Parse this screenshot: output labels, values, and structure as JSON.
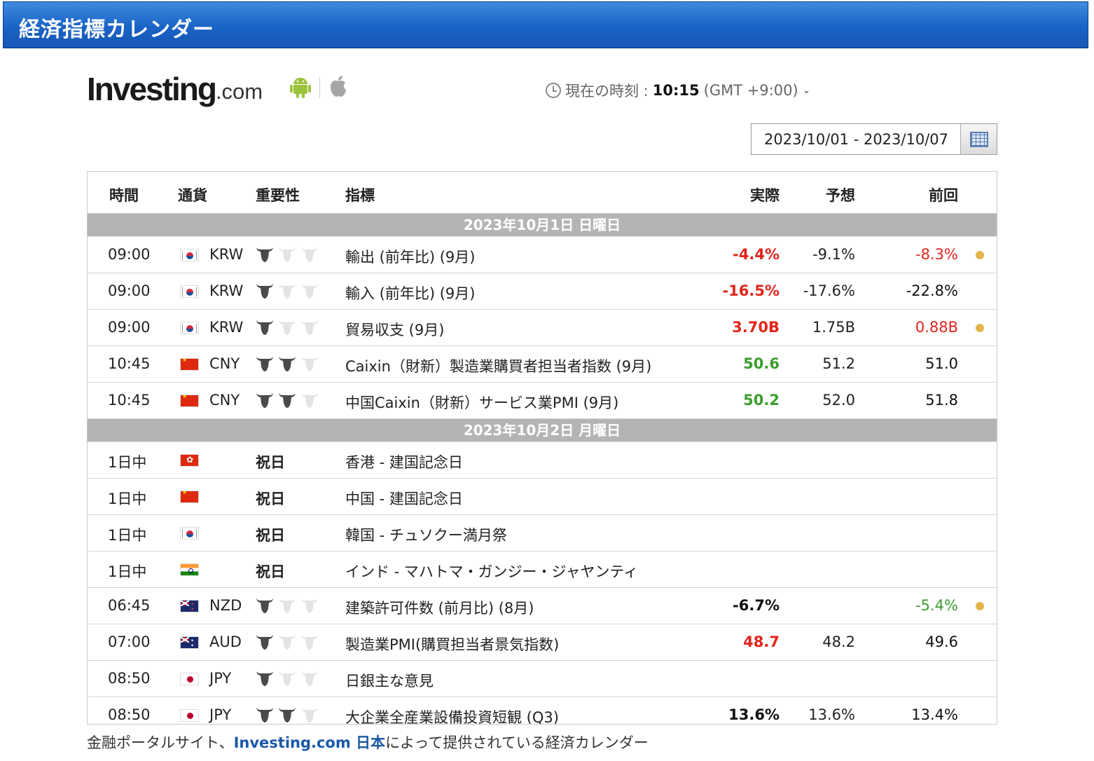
{
  "header": {
    "title": "経済指標カレンダー"
  },
  "logo": {
    "main": "Investing",
    "suffix": ".com"
  },
  "clock": {
    "label": "現在の時刻 : ",
    "time": "10:15",
    "tz": " (GMT +9:00)",
    "chevron": "⌄"
  },
  "date_range": {
    "value": "2023/10/01 - 2023/10/07"
  },
  "columns": {
    "time": "時間",
    "currency": "通貨",
    "importance": "重要性",
    "event": "指標",
    "actual": "実際",
    "forecast": "予想",
    "previous": "前回"
  },
  "groups": [
    {
      "date": "2023年10月1日 日曜日",
      "rows": [
        {
          "time": "09:00",
          "flag": "kr",
          "currency": "KRW",
          "importance": 1,
          "event": "輸出 (前年比) (9月)",
          "actual": "-4.4%",
          "actual_color": "red",
          "forecast": "-9.1%",
          "previous": "-8.3%",
          "previous_color": "red",
          "revised": true
        },
        {
          "time": "09:00",
          "flag": "kr",
          "currency": "KRW",
          "importance": 1,
          "event": "輸入 (前年比) (9月)",
          "actual": "-16.5%",
          "actual_color": "red",
          "forecast": "-17.6%",
          "previous": "-22.8%",
          "previous_color": "black",
          "revised": false
        },
        {
          "time": "09:00",
          "flag": "kr",
          "currency": "KRW",
          "importance": 1,
          "event": "貿易収支 (9月)",
          "actual": "3.70B",
          "actual_color": "red",
          "forecast": "1.75B",
          "previous": "0.88B",
          "previous_color": "red",
          "revised": true
        },
        {
          "time": "10:45",
          "flag": "cn",
          "currency": "CNY",
          "importance": 2,
          "event": "Caixin（財新）製造業購買者担当者指数 (9月)",
          "actual": "50.6",
          "actual_color": "green",
          "forecast": "51.2",
          "previous": "51.0",
          "previous_color": "black",
          "revised": false
        },
        {
          "time": "10:45",
          "flag": "cn",
          "currency": "CNY",
          "importance": 2,
          "event": "中国Caixin（財新）サービス業PMI (9月)",
          "actual": "50.2",
          "actual_color": "green",
          "forecast": "52.0",
          "previous": "51.8",
          "previous_color": "black",
          "revised": false
        }
      ]
    },
    {
      "date": "2023年10月2日 月曜日",
      "rows": [
        {
          "time": "1日中",
          "flag": "hk",
          "currency": "",
          "holiday": "祝日",
          "event": "香港 - 建国記念日"
        },
        {
          "time": "1日中",
          "flag": "cn",
          "currency": "",
          "holiday": "祝日",
          "event": "中国 - 建国記念日"
        },
        {
          "time": "1日中",
          "flag": "kr",
          "currency": "",
          "holiday": "祝日",
          "event": "韓国 - チュソクー満月祭"
        },
        {
          "time": "1日中",
          "flag": "in",
          "currency": "",
          "holiday": "祝日",
          "event": "インド - マハトマ・ガンジー・ジャヤンティ"
        },
        {
          "time": "06:45",
          "flag": "nz",
          "currency": "NZD",
          "importance": 1,
          "event": "建築許可件数 (前月比) (8月)",
          "actual": "-6.7%",
          "actual_color": "black",
          "forecast": "",
          "previous": "-5.4%",
          "previous_color": "green",
          "revised": true
        },
        {
          "time": "07:00",
          "flag": "au",
          "currency": "AUD",
          "importance": 1,
          "event": "製造業PMI(購買担当者景気指数)",
          "actual": "48.7",
          "actual_color": "red",
          "forecast": "48.2",
          "previous": "49.6",
          "previous_color": "black",
          "revised": false
        },
        {
          "time": "08:50",
          "flag": "jp",
          "currency": "JPY",
          "importance": 1,
          "event": "日銀主な意見",
          "actual": "",
          "actual_color": "black",
          "forecast": "",
          "previous": "",
          "previous_color": "black",
          "revised": false
        },
        {
          "time": "08:50",
          "flag": "jp",
          "currency": "JPY",
          "importance": 2,
          "event": "大企業全産業設備投資短観 (Q3)",
          "actual": "13.6%",
          "actual_color": "black",
          "forecast": "13.6%",
          "previous": "13.4%",
          "previous_color": "black",
          "revised": false
        }
      ]
    }
  ],
  "footer": {
    "prefix": "金融ポータルサイト、",
    "link": "Investing.com 日本",
    "suffix": "によって提供されている経済カレンダー"
  },
  "colors": {
    "title_bar": "#1a63c6",
    "date_row": "#b4b4b4",
    "red": "#e1251b",
    "green": "#3b9e2e",
    "revised_dot": "#e1b549",
    "link": "#1b58a8"
  }
}
